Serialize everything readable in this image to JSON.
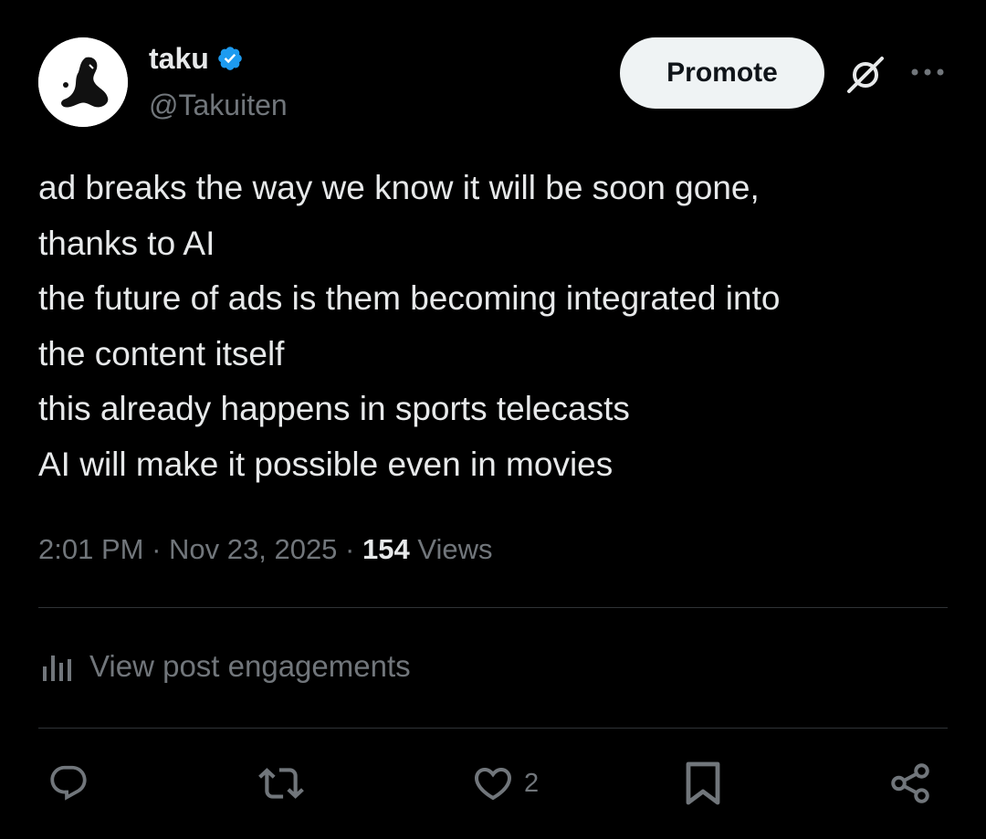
{
  "author": {
    "display_name": "taku",
    "handle": "@Takuiten",
    "verified": true
  },
  "header": {
    "promote_label": "Promote",
    "icons": [
      "grok-icon",
      "more-icon"
    ]
  },
  "post": {
    "lines": [
      "ad breaks the way we know it will be soon gone,",
      "thanks to AI",
      "the future of ads is them becoming integrated into",
      "the content itself",
      "this already happens in sports telecasts",
      "AI will make it possible even in movies"
    ]
  },
  "meta": {
    "time": "2:01 PM",
    "separator": " · ",
    "date": "Nov 23, 2025",
    "views_count": "154",
    "views_label": "Views"
  },
  "engagements": {
    "label": "View post engagements"
  },
  "actions": {
    "reply_count": "",
    "repost_count": "",
    "like_count": "2",
    "bookmark_count": ""
  },
  "colors": {
    "background": "#000000",
    "text_primary": "#e7e9ea",
    "text_secondary": "#71767b",
    "divider": "#2f3336",
    "verified_badge": "#1d9bf0",
    "promote_bg": "#eff3f4"
  }
}
